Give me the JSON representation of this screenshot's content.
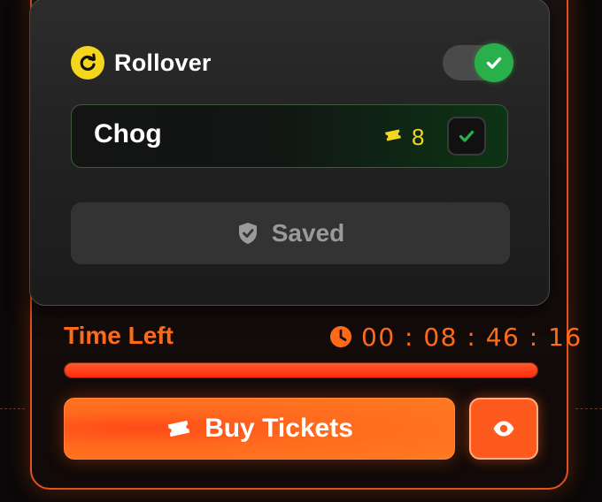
{
  "colors": {
    "accent_orange": "#ff6a1a",
    "success_green": "#2ab04a",
    "ticket_yellow": "#f4d61e",
    "popup_bg": "#2a2929"
  },
  "rollover": {
    "label": "Rollover",
    "icon": "rollover-refresh-icon",
    "enabled": true
  },
  "selection": {
    "name": "Chog",
    "ticket_icon": "ticket-icon",
    "ticket_count": "8",
    "checked": true
  },
  "save_button": {
    "icon": "shield-check-icon",
    "label": "Saved"
  },
  "timer": {
    "label": "Time Left",
    "icon": "clock-icon",
    "value": "00:08:46:16",
    "progress_fraction": 1.0
  },
  "buy_button": {
    "icon": "ticket-icon",
    "label": "Buy Tickets"
  },
  "view_button": {
    "icon": "eye-icon"
  }
}
